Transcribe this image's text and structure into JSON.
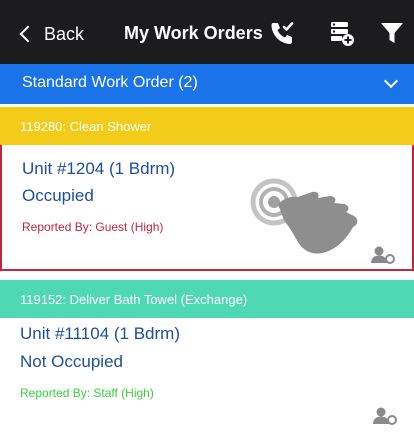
{
  "nav": {
    "back_label": "Back",
    "title": "My Work Orders",
    "icons": [
      "phone-checkmark-icon",
      "server-add-icon",
      "filter-icon"
    ]
  },
  "group": {
    "label": "Standard Work Order (2)"
  },
  "work_orders": [
    {
      "header": "119280: Clean Shower",
      "unit": "Unit #1204 (1 Bdrm)",
      "occupancy": "Occupied",
      "reported": "Reported By: Guest  (High)",
      "header_color": "#f2cc19",
      "reported_color": "#c0273a"
    },
    {
      "header": "119152: Deliver Bath Towel (Exchange)",
      "unit": "Unit #11104 (1 Bdrm)",
      "occupancy": "Not Occupied",
      "reported": "Reported By: Staff  (High)",
      "header_color": "#4fd8b4",
      "reported_color": "#37d23c"
    }
  ],
  "colors": {
    "topbar": "#1c1c1e",
    "group_header": "#1a73e8",
    "text_blue": "#1d4fa0",
    "selected_border": "#c0273a"
  }
}
